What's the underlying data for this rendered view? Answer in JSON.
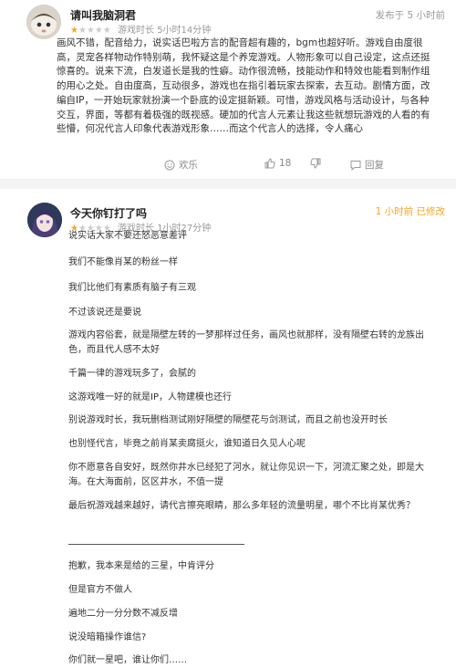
{
  "review1": {
    "username": "请叫我脑洞君",
    "rating": 1,
    "rating_max": 5,
    "playtime": "游戏时长 5小时14分钟",
    "posted": "发布于 5 小时前",
    "body": "画风不错，配音给力，说实话巴啦方言的配音超有趣的，bgm也超好听。游戏自由度很高，灵宠各样物动作特别萌，我怀疑这是个养宠游戏。人物形象可以自己设定，这点还挺惊喜的。说来下流，白发道长是我的性癖。动作很流畅，技能动作和特效也能看到制作组的用心之处。自由度高，互动很多，游戏也在指引着玩家去探索，去互动。剧情方面，改编自IP，一开始玩家就扮演一个卧底的设定挺新颖。可惜，游戏风格与活动设计，与各种交互，界面，等都有着极强的既视感。硬加的代言人元素让我这些就想玩游戏的人看的有些懵，何况代言人印象代表游戏形象……而这个代言人的选择，令人痛心",
    "actions": {
      "happy": "欢乐",
      "likes": "18",
      "reply": "回复"
    }
  },
  "review2": {
    "username": "今天你钉打了吗",
    "rating": 1,
    "rating_max": 5,
    "playtime": "游戏时长 1小时27分钟",
    "posted": "1 小时前 已修改",
    "lines": [
      "说实话大家不要还怒恶意差评",
      "我们不能像肖某的粉丝一样",
      "我们比他们有素质有脑子有三观",
      "不过该说还是要说",
      "游戏内容俗套，就是隔壁左转的一梦那样过任务，画风也就那样，没有隔壁右转的龙族出色，而且代人感不太好",
      "千篇一律的游戏玩多了，会腻的",
      "这游戏唯一好的就是IP，人物建模也还行",
      "别说游戏时长，我玩删档测试刚好隔壁的隔壁花与剑测试，而且之前也没开时长",
      "也别怪代言，毕竟之前肖某卖腐挺火，谁知道日久见人心呢",
      "你不愿意各自安好，既然你井水已经犯了河水，就让你见识一下，河流汇聚之处，即是大海。在大海面前，区区井水，不值一提",
      "最后祝游戏越来越好，请代言擦亮眼睛，那么多年轻的流量明星，哪个不比肖某优秀？",
      "抱歉，我本来是给的三星，中肯评分",
      "但是官方不做人",
      "遍地二分一分分数不减反增",
      "说没暗箱操作谁信?",
      "你们就一星吧，谁让你们……"
    ]
  },
  "colors": {
    "star": "#f5a623",
    "edited": "#f5a623",
    "meta": "#999999"
  }
}
